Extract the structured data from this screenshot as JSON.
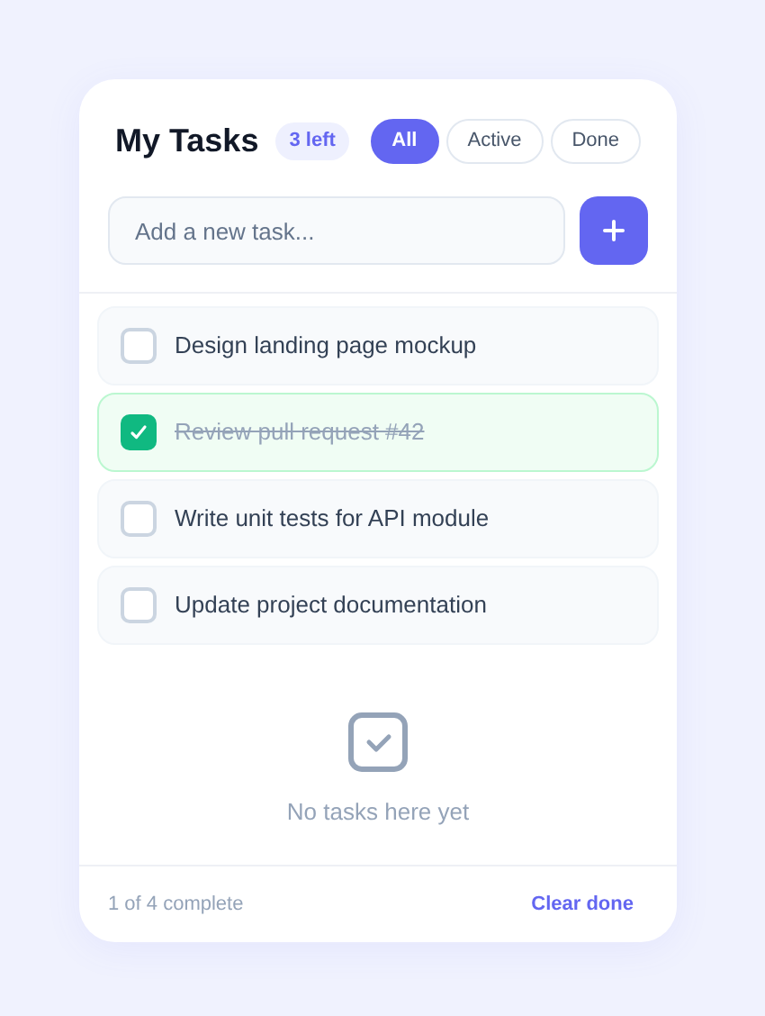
{
  "header": {
    "title": "My Tasks",
    "badge": "3 left"
  },
  "filters": [
    {
      "label": "All",
      "selected": true
    },
    {
      "label": "Active",
      "selected": false
    },
    {
      "label": "Done",
      "selected": false
    }
  ],
  "new_task": {
    "placeholder": "Add a new task..."
  },
  "tasks": [
    {
      "text": "Design landing page mockup",
      "checked": false
    },
    {
      "text": "Review pull request #42",
      "checked": true
    },
    {
      "text": "Write unit tests for API module",
      "checked": false
    },
    {
      "text": "Update project documentation",
      "checked": false
    }
  ],
  "empty_state": {
    "text": "No tasks here yet"
  },
  "footer": {
    "summary": "1 of 4 complete",
    "action": "Clear done"
  }
}
